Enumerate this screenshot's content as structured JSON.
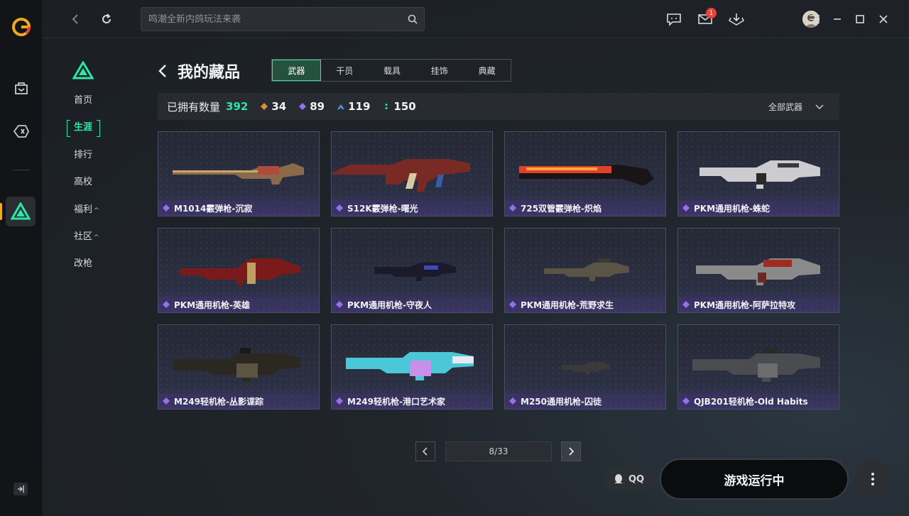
{
  "topbar": {
    "search_placeholder": "鸣潮全新内鸽玩法来袭",
    "mail_badge": "1"
  },
  "subnav": {
    "items": [
      {
        "label": "首页"
      },
      {
        "label": "生涯"
      },
      {
        "label": "排行"
      },
      {
        "label": "高校"
      },
      {
        "label": "福利",
        "caret": "^"
      },
      {
        "label": "社区",
        "caret": "^"
      },
      {
        "label": "改枪"
      }
    ]
  },
  "header": {
    "title": "我的藏品",
    "tabs": [
      "武器",
      "干员",
      "载具",
      "挂饰",
      "典藏"
    ]
  },
  "stats": {
    "label": "已拥有数量",
    "total": "392",
    "tiers": [
      {
        "value": "34",
        "color": "#e08a3c"
      },
      {
        "value": "89",
        "color": "#9b6ee8"
      },
      {
        "value": "119",
        "color": "#4a9be8"
      },
      {
        "value": "150",
        "color": "#2ee6a4"
      }
    ],
    "filter": "全部武器"
  },
  "items": [
    {
      "name": "M1014霰弹枪-沉寂",
      "icon": "shotgun-gold"
    },
    {
      "name": "S12K霰弹枪-曙光",
      "icon": "shotgun-red"
    },
    {
      "name": "725双管霰弹枪-炽焰",
      "icon": "shotgun-flame"
    },
    {
      "name": "PKM通用机枪-蛛蛇",
      "icon": "mg-white"
    },
    {
      "name": "PKM通用机枪-英雄",
      "icon": "mg-red"
    },
    {
      "name": "PKM通用机枪-守夜人",
      "icon": "mg-blue"
    },
    {
      "name": "PKM通用机枪-荒野求生",
      "icon": "mg-tan"
    },
    {
      "name": "PKM通用机枪-阿萨拉特攻",
      "icon": "mg-redgrey"
    },
    {
      "name": "M249轻机枪-丛影谍踪",
      "icon": "lmg-camo"
    },
    {
      "name": "M249轻机枪-港口艺术家",
      "icon": "lmg-cyan"
    },
    {
      "name": "M250通用机枪-囚徒",
      "icon": "mg-small"
    },
    {
      "name": "QJB201轻机枪-Old Habits",
      "icon": "lmg-grey"
    }
  ],
  "pager": {
    "text": "8/33"
  },
  "bottom": {
    "qq_label": "QQ",
    "game_status": "游戏运行中"
  }
}
